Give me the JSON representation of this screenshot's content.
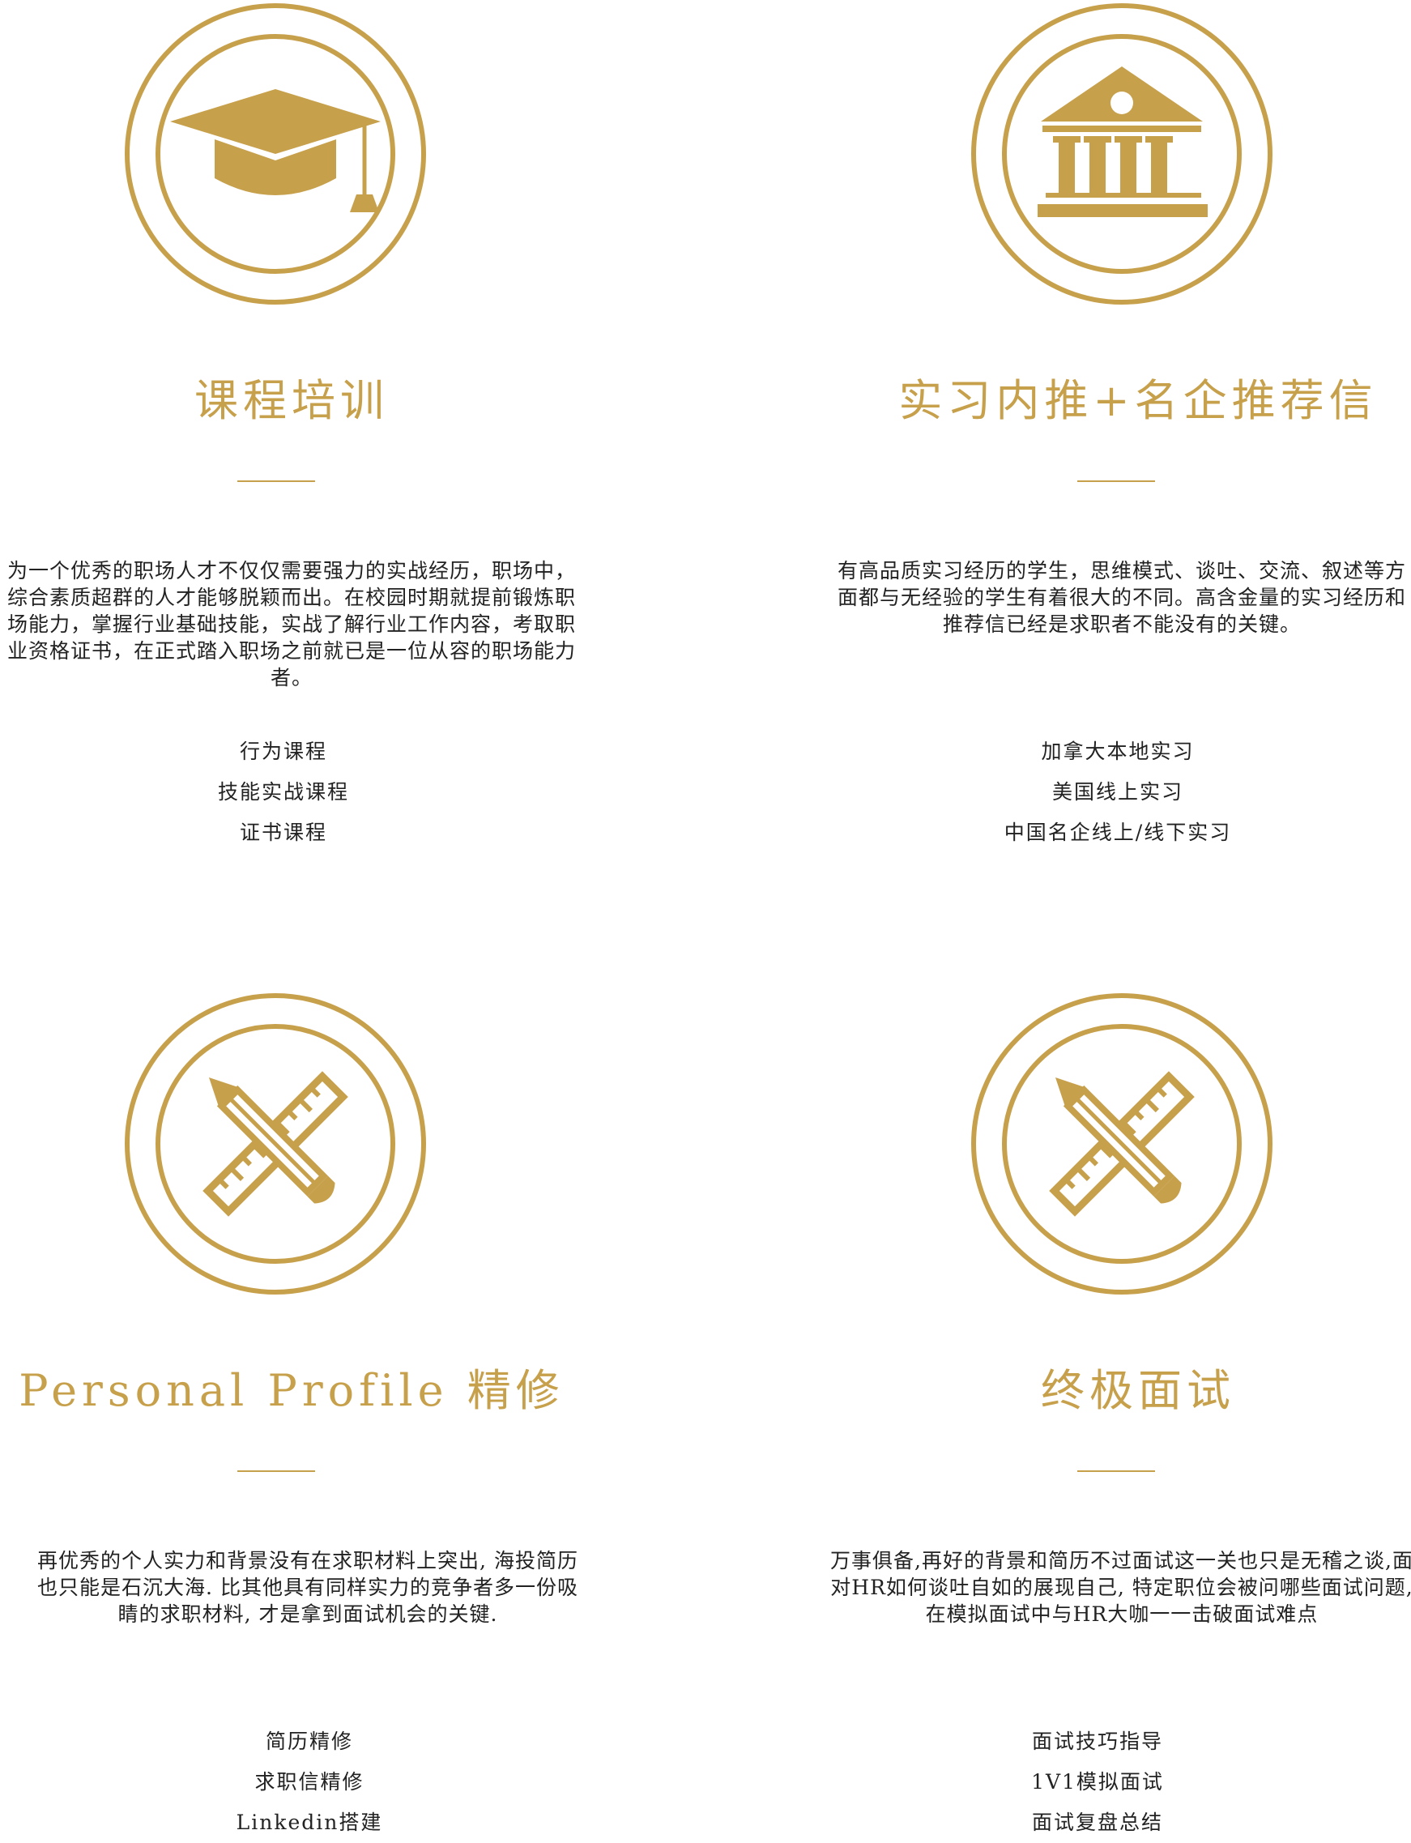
{
  "colors": {
    "accent": "#c7a04c",
    "text": "#222222",
    "background": "#ffffff"
  },
  "services": [
    {
      "icon": "graduation-cap-icon",
      "title": "课程培训",
      "description": "为一个优秀的职场人才不仅仅需要强力的实战经历，职场中，综合素质超群的人才能够脱颖而出。在校园时期就提前锻炼职场能力，掌握行业基础技能，实战了解行业工作内容，考取职业资格证书，在正式踏入职场之前就已是一位从容的职场能力者。",
      "items": [
        "行为课程",
        "技能实战课程",
        "证书课程"
      ]
    },
    {
      "icon": "institution-building-icon",
      "title": "实习内推+名企推荐信",
      "description": "有高品质实习经历的学生，思维模式、谈吐、交流、叙述等方面都与无经验的学生有着很大的不同。高含金量的实习经历和推荐信已经是求职者不能没有的关键。",
      "items": [
        "加拿大本地实习",
        "美国线上实习",
        "中国名企线上/线下实习"
      ]
    },
    {
      "icon": "pencil-ruler-icon",
      "title": "Personal Profile 精修",
      "description": "再优秀的个人实力和背景没有在求职材料上突出, 海投简历也只能是石沉大海. 比其他具有同样实力的竞争者多一份吸睛的求职材料, 才是拿到面试机会的关键.",
      "items": [
        "简历精修",
        "求职信精修",
        "Linkedin搭建"
      ]
    },
    {
      "icon": "pencil-ruler-icon",
      "title": "终极面试",
      "description": "万事俱备,再好的背景和简历不过面试这一关也只是无稽之谈,面对HR如何谈吐自如的展现自己, 特定职位会被问哪些面试问题, 在模拟面试中与HR大咖一一击破面试难点",
      "items": [
        "面试技巧指导",
        "1V1模拟面试",
        "面试复盘总结"
      ]
    }
  ]
}
